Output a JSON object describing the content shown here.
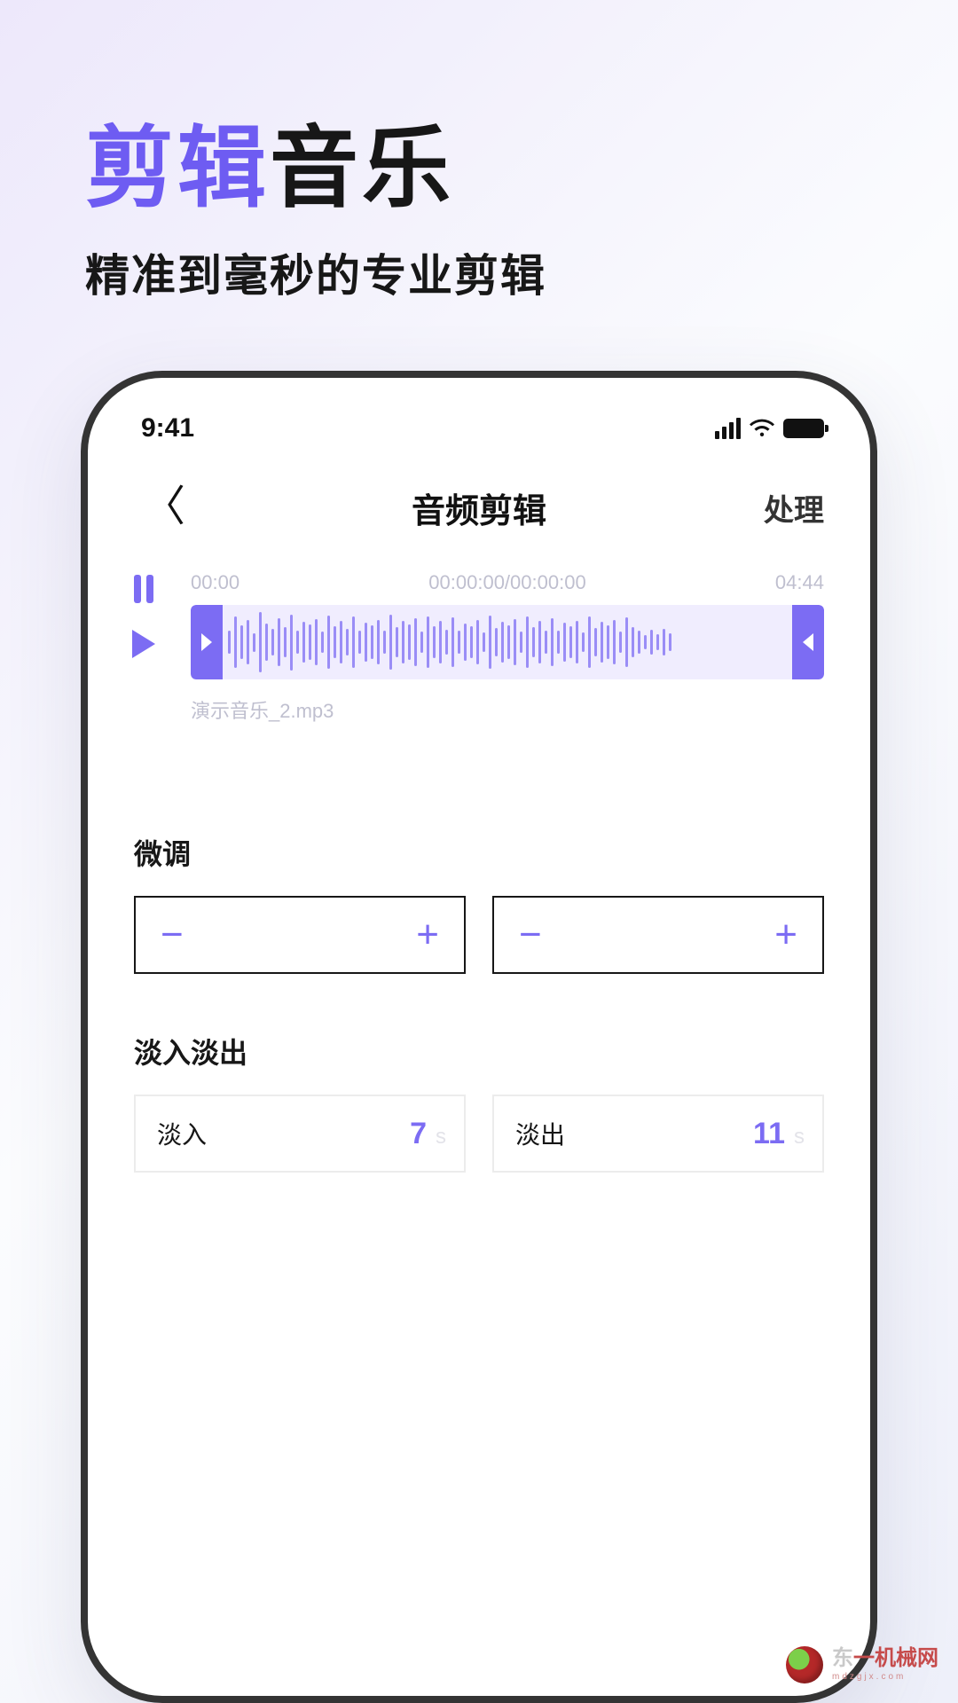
{
  "promo": {
    "title_accent": "剪辑",
    "title_rest": "音乐",
    "subtitle": "精准到毫秒的专业剪辑"
  },
  "status": {
    "time": "9:41"
  },
  "nav": {
    "back_glyph": "〈",
    "title": "音频剪辑",
    "action": "处理"
  },
  "editor": {
    "time_start": "00:00",
    "time_center": "00:00:00/00:00:00",
    "time_end": "04:44",
    "file_name": "演示音乐_2.mp3"
  },
  "fine_tune": {
    "title": "微调",
    "minus": "−",
    "plus": "+"
  },
  "fade": {
    "title": "淡入淡出",
    "in_label": "淡入",
    "in_value": "7",
    "out_label": "淡出",
    "out_value": "11",
    "unit": "s"
  },
  "watermark": {
    "cn_gray": "东",
    "cn_rest": "一机械网",
    "en": "mdzgjx.com"
  }
}
